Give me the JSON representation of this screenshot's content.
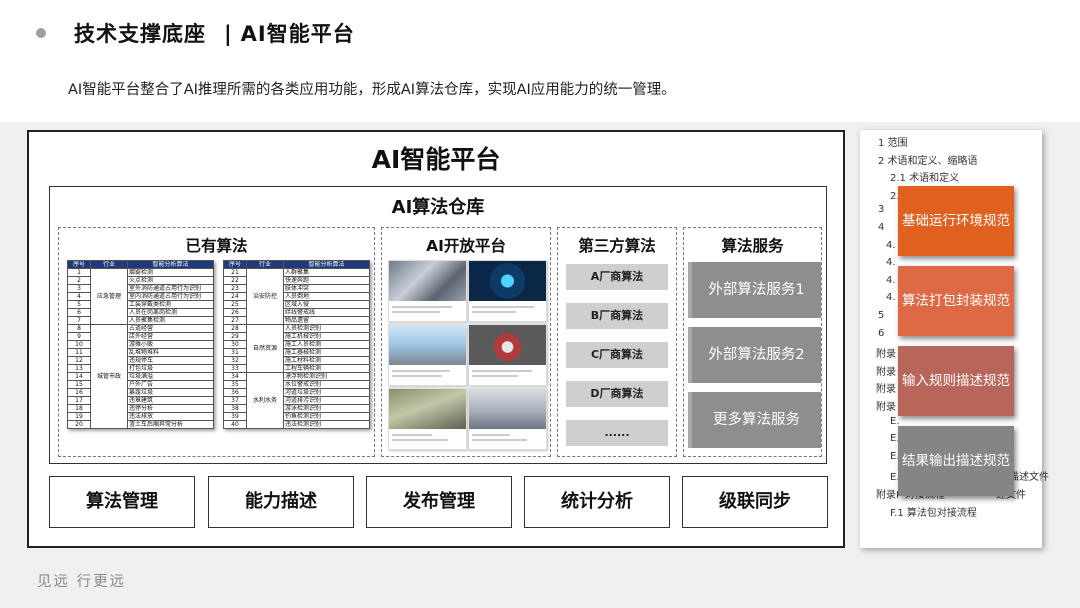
{
  "header": {
    "title": "技术支撑底座",
    "separator": "|",
    "section": "AI智能平台"
  },
  "subtitle": "AI智能平台整合了AI推理所需的各类应用功能，形成AI算法仓库，实现AI应用能力的统一管理。",
  "platform": {
    "title": "AI智能平台",
    "warehouse": {
      "title": "AI算法仓库",
      "existing": {
        "title": "已有算法",
        "headers": [
          "序号",
          "行业",
          "智能分析算法"
        ],
        "table1": {
          "rows": [
            [
              "1",
              "应急管理",
              "烟雾检测"
            ],
            [
              "2",
              "",
              "火点检测"
            ],
            [
              "3",
              "",
              "室外消防通道占用行为识别"
            ],
            [
              "4",
              "",
              "室内消防通道占用行为识别"
            ],
            [
              "5",
              "",
              "工装穿戴类检测"
            ],
            [
              "6",
              "",
              "人员在岗离岗检测"
            ],
            [
              "7",
              "",
              "人员聚集检测"
            ],
            [
              "8",
              "城管市政",
              "占道经营"
            ],
            [
              "9",
              "",
              "店外经营"
            ],
            [
              "10",
              "",
              "游摊小贩"
            ],
            [
              "11",
              "",
              "乱堆物堆料"
            ],
            [
              "12",
              "",
              "违规停车"
            ],
            [
              "13",
              "",
              "打包垃圾"
            ],
            [
              "14",
              "",
              "垃圾满溢"
            ],
            [
              "15",
              "",
              "户外广告"
            ],
            [
              "16",
              "",
              "暴露垃圾"
            ],
            [
              "17",
              "",
              "违章建筑"
            ],
            [
              "18",
              "",
              "违停分析"
            ],
            [
              "19",
              "",
              "违法排放"
            ],
            [
              "20",
              "",
              "渣土车后厢异常分析"
            ]
          ]
        },
        "table2": {
          "rows": [
            [
              "21",
              "治安防控",
              "人群聚集"
            ],
            [
              "22",
              "",
              "快速奔跑"
            ],
            [
              "23",
              "",
              "肢体冲突"
            ],
            [
              "24",
              "",
              "人员倒地"
            ],
            [
              "25",
              "",
              "区域入侵"
            ],
            [
              "26",
              "",
              "绊线警戒线"
            ],
            [
              "27",
              "",
              "物品遗留"
            ],
            [
              "28",
              "自然资源",
              "人员检测识别"
            ],
            [
              "29",
              "",
              "施工机械识别"
            ],
            [
              "30",
              "",
              "施工人员检测"
            ],
            [
              "31",
              "",
              "施工器械检测"
            ],
            [
              "32",
              "",
              "施工材料检测"
            ],
            [
              "33",
              "",
              "工程车辆检测"
            ],
            [
              "34",
              "水利水务",
              "漂浮物检测识别"
            ],
            [
              "35",
              "",
              "水位警戒识别"
            ],
            [
              "36",
              "",
              "河道垃圾识别"
            ],
            [
              "37",
              "",
              "河道排污识别"
            ],
            [
              "38",
              "",
              "游泳检测识别"
            ],
            [
              "39",
              "",
              "钓鱼检测识别"
            ],
            [
              "40",
              "",
              "违法检测识别"
            ]
          ]
        }
      },
      "open_platform": {
        "title": "AI开放平台"
      },
      "third_party": {
        "title": "第三方算法",
        "vendors": [
          "A厂商算法",
          "B厂商算法",
          "C厂商算法",
          "D厂商算法",
          "......"
        ]
      },
      "services": {
        "title": "算法服务",
        "items": [
          "外部算法服务1",
          "外部算法服务2",
          "更多算法服务"
        ]
      }
    },
    "features": [
      "算法管理",
      "能力描述",
      "发布管理",
      "统计分析",
      "级联同步"
    ]
  },
  "toc": {
    "items": [
      "1    范围",
      "2    术语和定义、缩略语",
      "2.1    术语和定义",
      "2.2    缩略语",
      "3",
      "4",
      "4.",
      "4.",
      "4.",
      "4.",
      "5",
      "6",
      "附录",
      "附录",
      "附录",
      "附录",
      "E.",
      "E.",
      "E.",
      "E.4 检测分类算法输出字典描述文件",
      "附录F 对接流程",
      "F.1 算法包对接流程"
    ],
    "fragment": "述文件"
  },
  "spec_cards": [
    {
      "label": "基础运行环境规范",
      "color": "#e0601f"
    },
    {
      "label": "算法打包封装规范",
      "color": "#de6a45"
    },
    {
      "label": "输入规则描述规范",
      "color": "#b9665a"
    },
    {
      "label": "结果输出描述规范",
      "color": "#858585"
    }
  ],
  "footer": {
    "slogan": "见远  行更远"
  }
}
